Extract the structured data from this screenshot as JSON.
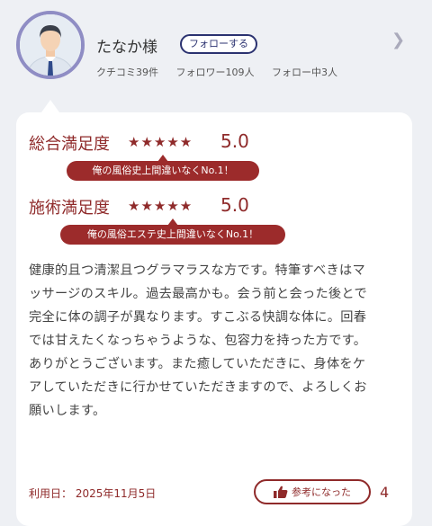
{
  "profile": {
    "username": "たなか様",
    "follow_label": "フォローする",
    "stats": {
      "reviews": "クチコミ39件",
      "followers": "フォロワー109人",
      "following": "フォロー中3人"
    }
  },
  "ratings": [
    {
      "label": "総合満足度",
      "stars": "★★★★★",
      "score": "5.0",
      "comment": "俺の風俗史上間違いなくNo.1！"
    },
    {
      "label": "施術満足度",
      "stars": "★★★★★",
      "score": "5.0",
      "comment": "俺の風俗エステ史上間違いなくNo.1！"
    }
  ],
  "review_lines": [
    "健康的且つ清潔且つグラマラスな方です。特筆すべきはマ",
    "ッサージのスキル。過去最高かも。会う前と会った後とで",
    "完全に体の調子が異なります。すこぶる快調な体に。回春",
    "では甘えたくなっちゃうような、包容力を持った方です。",
    "ありがとうございます。また癒していただきに、身体をケ",
    "アしていただきに行かせていただきますので、よろしくお",
    "願いします。"
  ],
  "footer": {
    "usage_date": "利用日： 2025年11月5日",
    "helpful_label": "参考になった",
    "helpful_count": "4"
  },
  "colors": {
    "accent": "#8f2a2a",
    "pill": "#9c2b2b",
    "follow": "#2b3270",
    "avatar_ring": "#8f8dc4"
  }
}
